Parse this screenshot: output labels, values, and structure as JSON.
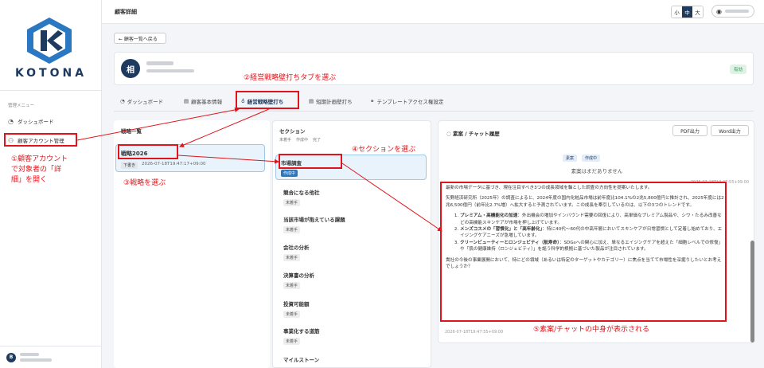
{
  "app": {
    "brand": "KOTONA",
    "page_title": "顧客詳細",
    "menu_title": "管理メニュー",
    "menu": [
      {
        "icon": "dashboard-icon",
        "label": "ダッシュボード"
      },
      {
        "icon": "users-icon",
        "label": "顧客アカウント管理"
      }
    ],
    "user_initial": "B",
    "font_size": {
      "small": "小",
      "mid": "中",
      "large": "大",
      "selected": "中"
    }
  },
  "customer": {
    "back_label": "← 顧客一覧へ戻る",
    "avatar": "相",
    "status": "有効"
  },
  "tabs": [
    {
      "label": "ダッシュボード"
    },
    {
      "label": "顧客基本情報"
    },
    {
      "label": "経営戦略壁打ち",
      "active": true
    },
    {
      "label": "短期計画壁打ち"
    },
    {
      "label": "テンプレートアクセス権設定"
    }
  ],
  "strategy": {
    "header": "戦略一覧",
    "item_name": "戦略2026",
    "item_status": "下書き",
    "item_time": "2026-07-18T19:47:17+09:00"
  },
  "sections": {
    "header": "セクション",
    "legend": [
      "未着手",
      "作成中",
      "完了"
    ],
    "items": [
      {
        "name": "市場調査",
        "status": "作成中"
      },
      {
        "name": "競合になる他社",
        "status": "未着手"
      },
      {
        "name": "当該市場が抱えている課題",
        "status": "未着手"
      },
      {
        "name": "会社の分析",
        "status": "未着手"
      },
      {
        "name": "決算書の分析",
        "status": "未着手"
      },
      {
        "name": "投資可能額",
        "status": "未着手"
      },
      {
        "name": "事業化する道筋",
        "status": "未着手"
      },
      {
        "name": "マイルストーン",
        "status": ""
      }
    ]
  },
  "chat": {
    "header": "素案 / チャット履歴",
    "pdf": "PDF出力",
    "word": "Word出力",
    "tag1": "素案",
    "tag2": "作成中",
    "empty": "素案はまだありません",
    "time1": "2026-07-18T19:47:55+09:00",
    "time2": "2026-07-18T19:47:55+09:00",
    "p1": "最新の市場データに基づき、現在注目すべき3つの成長領域を軸とした調査の方向性を提案いたします。",
    "p2": "矢野経済研究所（2025年）の調査によると、2024年度の国内化粧品市場は前年度比104.1%の2兆5,800億円と推計され、2025年度には2兆6,500億円（前年比2.7%増）へ拡大すると予測されています。この成長を牽引しているのは、以下の3つのトレンドです。",
    "l1b": "プレミアム・高機能化の加速",
    "l1": "：外出機会の増加やインバウンド需要の回復により、高単価なプレミアム製品や、シワ・たるみ改善などの高機能スキンケアが市場を押し上げています。",
    "l2b": "メンズコスメの「習慣化」と「高年齢化」",
    "l2": "：特に40代〜60代の中高年層においてスキンケアが日常習慣として定着し始めており、エイジングケアニーズが急増しています。",
    "l3b": "クリーンビューティーとロンジェビティ（航寿命）",
    "l3": "：SDGsへの関心に加え、単なるエイジングケアを超えた「細胞レベルでの修復」や「肌の健康維持（ロンジェビティ）」を謳う科学的根拠に基づいた製品が注目されています。",
    "p3": "貴社の今後の事業展開において、特にどの領域（あるいは特定のターゲットやカテゴリー）に焦点を当てて市場性を深掘りしたいとお考えでしょうか？"
  },
  "annotations": {
    "a1": "①顧客アカウント\nで対象者の「詳\n細」を開く",
    "a2": "②経営戦略壁打ちタブを選ぶ",
    "a3": "③戦略を選ぶ",
    "a4": "④セクションを選ぶ",
    "a5": "⑤素案/チャットの中身が表示される"
  }
}
